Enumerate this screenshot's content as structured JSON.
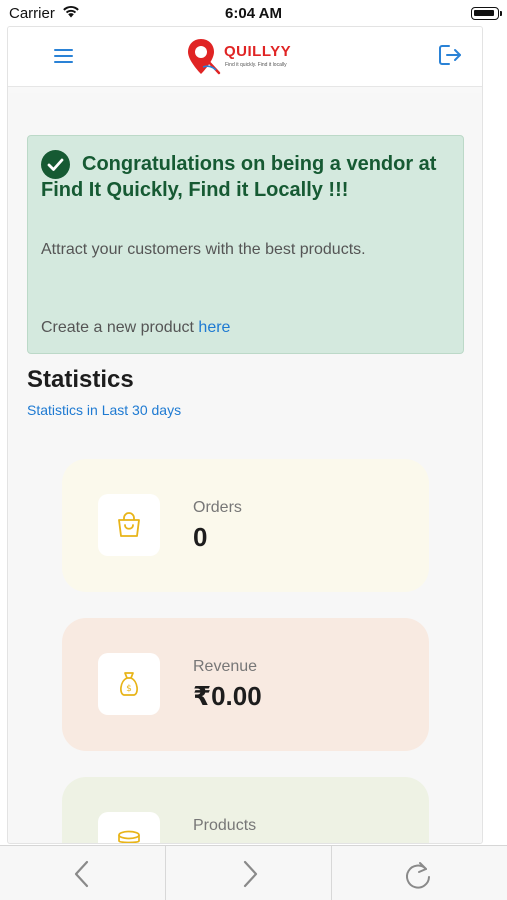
{
  "status_bar": {
    "carrier": "Carrier",
    "time": "6:04 AM"
  },
  "header": {
    "brand": "QUILLYY",
    "tagline": "Find it quickly. Find it locally",
    "brand_color": "#e02424",
    "icons": [
      "menu-icon",
      "logout-icon"
    ]
  },
  "congrats": {
    "title": "Congratulations on being a vendor at Find It Quickly, Find it Locally !!!",
    "message": "Attract your customers with the best products.",
    "create_prefix": "Create a new product ",
    "create_link": "here",
    "background": "#d4e9de",
    "title_color": "#165a33"
  },
  "statistics": {
    "title": "Statistics",
    "subtitle": "Statistics in Last 30 days",
    "cards": [
      {
        "label": "Orders",
        "value": "0",
        "icon": "shopping-bag-icon",
        "background": "#fbf9ec"
      },
      {
        "label": "Revenue",
        "value": "₹0.00",
        "icon": "money-bag-icon",
        "background": "#f8eae1"
      },
      {
        "label": "Products",
        "value": "",
        "icon": "coin-stack-icon",
        "background": "#eef2e4"
      }
    ]
  },
  "toolbar": {
    "icons": [
      "back-arrow-icon",
      "forward-arrow-icon",
      "reload-icon"
    ]
  }
}
